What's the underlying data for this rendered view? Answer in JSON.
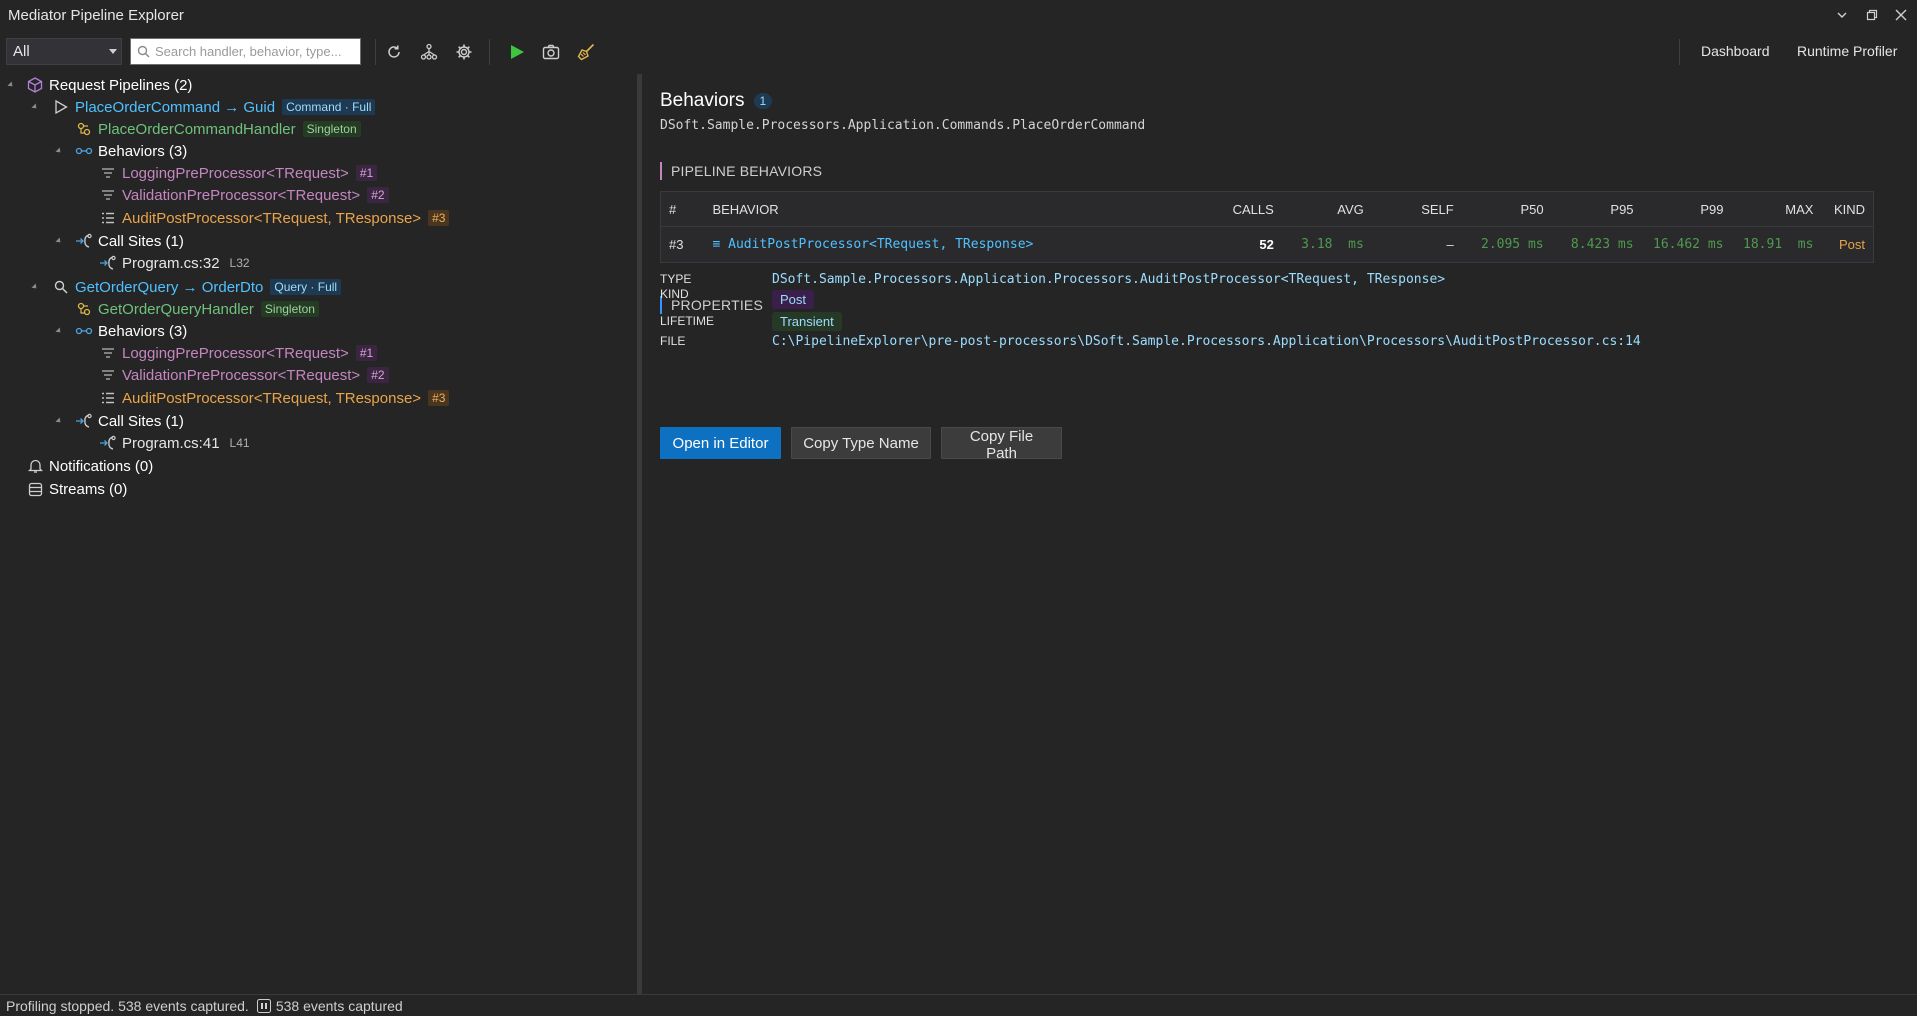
{
  "window": {
    "title": "Mediator Pipeline Explorer"
  },
  "toolbar": {
    "filter_value": "All",
    "search_placeholder": "Search handler, behavior, type...",
    "dashboard_label": "Dashboard",
    "profiler_label": "Runtime Profiler",
    "icons": [
      "refresh-icon",
      "graph-icon",
      "settings-icon",
      "play-icon",
      "camera-icon",
      "broom-icon"
    ]
  },
  "tree": {
    "request_pipelines": "Request Pipelines (2)",
    "pipelines": [
      {
        "name": "PlaceOrderCommand → Guid",
        "tag": "Command · Full",
        "handler": "PlaceOrderCommandHandler",
        "handler_tag": "Singleton",
        "behaviors_label": "Behaviors (3)",
        "behaviors": [
          {
            "name": "LoggingPreProcessor<TRequest>",
            "order": "#1"
          },
          {
            "name": "ValidationPreProcessor<TRequest>",
            "order": "#2"
          },
          {
            "name": "AuditPostProcessor<TRequest, TResponse>",
            "order": "#3"
          }
        ],
        "callsites_label": "Call Sites (1)",
        "callsite": "Program.cs:32",
        "callsite_line": "L32"
      },
      {
        "name": "GetOrderQuery → OrderDto",
        "tag": "Query · Full",
        "handler": "GetOrderQueryHandler",
        "handler_tag": "Singleton",
        "behaviors_label": "Behaviors (3)",
        "behaviors": [
          {
            "name": "LoggingPreProcessor<TRequest>",
            "order": "#1"
          },
          {
            "name": "ValidationPreProcessor<TRequest>",
            "order": "#2"
          },
          {
            "name": "AuditPostProcessor<TRequest, TResponse>",
            "order": "#3"
          }
        ],
        "callsites_label": "Call Sites (1)",
        "callsite": "Program.cs:41",
        "callsite_line": "L41"
      }
    ],
    "notifications": "Notifications (0)",
    "streams": "Streams (0)"
  },
  "detail": {
    "title": "Behaviors",
    "count": "1",
    "subtitle": "DSoft.Sample.Processors.Application.Commands.PlaceOrderCommand",
    "pipeline_section": "PIPELINE BEHAVIORS",
    "columns": [
      "#",
      "BEHAVIOR",
      "CALLS",
      "AVG",
      "SELF",
      "P50",
      "P95",
      "P99",
      "MAX",
      "KIND"
    ],
    "rows": [
      {
        "order": "#3",
        "behavior": "≡ AuditPostProcessor<TRequest, TResponse>",
        "calls": "52",
        "avg": "3.18  ms",
        "self": "–",
        "p50": "2.095 ms",
        "p95": "8.423 ms",
        "p99": "16.462 ms",
        "max": "18.91  ms",
        "kind": "Post"
      }
    ],
    "properties_section": "PROPERTIES",
    "properties": {
      "type_label": "TYPE",
      "type_value": "DSoft.Sample.Processors.Application.Processors.AuditPostProcessor<TRequest, TResponse>",
      "kind_label": "KIND",
      "kind_value": "Post",
      "lifetime_label": "LIFETIME",
      "lifetime_value": "Transient",
      "file_label": "FILE",
      "file_value": "C:\\PipelineExplorer\\pre-post-processors\\DSoft.Sample.Processors.Application\\Processors\\AuditPostProcessor.cs:14"
    },
    "buttons": {
      "open": "Open in Editor",
      "copy_type": "Copy Type Name",
      "copy_path": "Copy File Path"
    }
  },
  "status": {
    "message": "Profiling stopped. 538 events captured.",
    "events": "538 events captured"
  },
  "colors": {
    "accent": "#0e70c0",
    "link": "#4fc1ff",
    "handler": "#6fc27a",
    "behavior": "#c586c0",
    "post": "#e8a44a",
    "section_purple": "#c586c0",
    "section_blue": "#3794ff"
  }
}
